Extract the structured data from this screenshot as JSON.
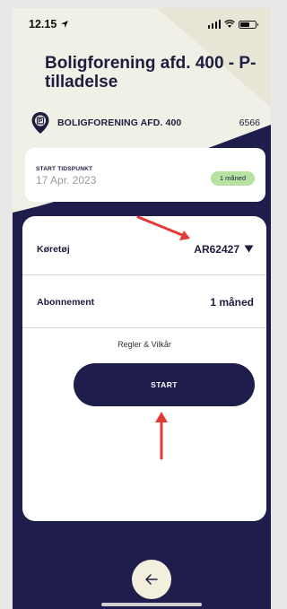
{
  "status_bar": {
    "time": "12.15"
  },
  "header": {
    "title": "Boligforening afd. 400 - P-tilladelse",
    "org_name": "BOLIGFORENING AFD. 400",
    "org_code": "6566"
  },
  "start_card": {
    "label": "START TIDSPUNKT",
    "date": "17 Apr. 2023",
    "badge": "1 måned"
  },
  "form": {
    "vehicle_label": "Køretøj",
    "vehicle_value": "AR62427",
    "subscription_label": "Abonnement",
    "subscription_value": "1 måned",
    "terms_link": "Regler & Vilkår",
    "start_button": "START"
  },
  "colors": {
    "navy": "#1f1d4b",
    "cream": "#f1f0e6",
    "badge_green": "#b6e3a2",
    "annotation_red": "#e53935"
  },
  "icons": {
    "location": "location-arrow-icon",
    "org": "parking-pin-icon",
    "caret": "caret-down-icon",
    "back": "arrow-left-icon"
  }
}
